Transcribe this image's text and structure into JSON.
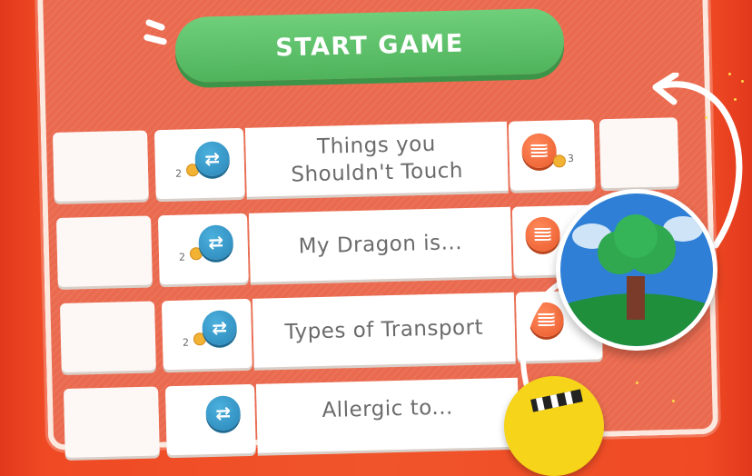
{
  "start_button": {
    "label": "START GAME"
  },
  "topics": [
    {
      "title_line1": "Things you",
      "title_line2": "Shouldn't Touch",
      "swap_cost": "2",
      "right_cost": "3"
    },
    {
      "title_line1": "My Dragon is...",
      "title_line2": "",
      "swap_cost": "2",
      "right_cost": ""
    },
    {
      "title_line1": "Types of Transport",
      "title_line2": "",
      "swap_cost": "2",
      "right_cost": ""
    },
    {
      "title_line1": "Allergic to...",
      "title_line2": "",
      "swap_cost": "",
      "right_cost": ""
    }
  ],
  "icons": {
    "swap": "swap-arrows-icon",
    "refresh": "shuffle-icon",
    "coin": "coin-icon",
    "tree": "tree-badge-icon",
    "clapper": "clapperboard-icon",
    "curved_arrow": "curved-arrow-icon"
  },
  "colors": {
    "background": "#ef4a24",
    "panel": "#ea6a4f",
    "start_green": "#5bbf68",
    "swap_blue": "#2f93c5",
    "refresh_orange": "#f06a3a",
    "badge_yellow": "#f6d419"
  }
}
